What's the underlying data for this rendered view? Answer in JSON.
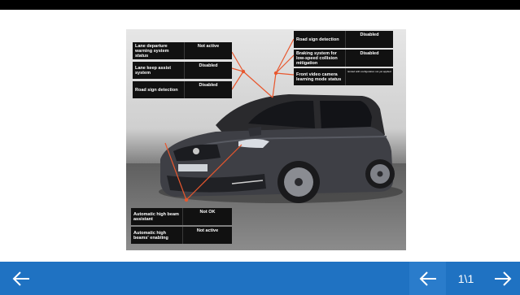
{
  "navigation": {
    "page_indicator": "1\\1"
  },
  "colors": {
    "bar": "#1f72c2",
    "callout_line": "#e8572e",
    "panel": "#111111"
  },
  "panels": {
    "left_top": [
      {
        "label": "Lane departure warning  system status",
        "value": "Not active"
      },
      {
        "label": "Lane keep assist system",
        "value": "Disabled"
      },
      {
        "label": "Road sign detection",
        "value": "Disabled"
      }
    ],
    "right_top": [
      {
        "label": "Road sign detection",
        "value": "Disabled"
      },
      {
        "label": "Braking system for low-speed  collision mitigation",
        "value": "Disabled"
      },
      {
        "label": "Front video camera learning  mode status",
        "value": "Ended with configuration not yet applied"
      }
    ],
    "bottom": [
      {
        "label": "Automatic high beam assistant",
        "value": "Not OK"
      },
      {
        "label": "Automatic high beams' enabling",
        "value": "Not active"
      }
    ]
  },
  "icons": {
    "back": "arrow-left-icon",
    "prev": "arrow-left-icon",
    "next": "arrow-right-icon"
  }
}
